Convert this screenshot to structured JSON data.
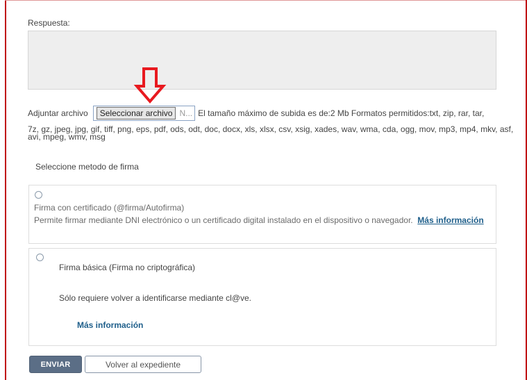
{
  "response": {
    "label": "Respuesta:",
    "value": ""
  },
  "attachment": {
    "label": "Adjuntar archivo",
    "button_label": "Seleccionar archivo",
    "no_file_text": "N...",
    "help_line1": "El tamaño máximo de subida es de:2 Mb Formatos permitidos:txt, zip, rar, tar,",
    "help_line2": "7z, gz, jpeg, jpg, gif, tiff, png, eps, pdf, ods, odt, doc, docx, xls, xlsx, csv, xsig, xades, wav, wma, cda, ogg, mov, mp3, mp4, mkv, asf, avi, mpeg, wmv, msg"
  },
  "annotation": {
    "arrow_icon": "down-arrow-icon",
    "arrow_color": "#e8191f"
  },
  "signature": {
    "heading": "Seleccione metodo de firma",
    "options": [
      {
        "title": "Firma con certificado (@firma/Autofirma)",
        "description": "Permite firmar mediante DNI electrónico o un certificado digital instalado en el dispositivo o navegador.",
        "more_link": "Más información"
      },
      {
        "title": "Firma básica (Firma no criptográfica)",
        "description": "Sólo requiere volver a identificarse mediante cl@ve.",
        "more_link": "Más información"
      }
    ]
  },
  "actions": {
    "send_label": "ENVIAR",
    "back_label": "Volver al expediente"
  },
  "colors": {
    "frame": "#c0000c",
    "link": "#1f5f8b",
    "primary_button": "#5b6e86"
  }
}
